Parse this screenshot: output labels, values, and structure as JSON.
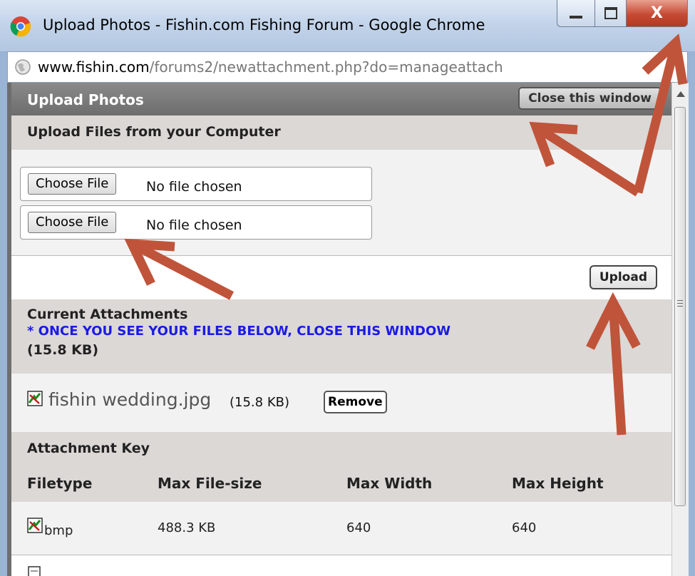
{
  "window": {
    "title": "Upload Photos - Fishin.com Fishing Forum - Google Chrome",
    "minimize_icon": "minimize-icon",
    "maximize_icon": "maximize-icon",
    "close_label": "X"
  },
  "address": {
    "host": "www.fishin.com",
    "path": "/forums2/newattachment.php?do=manageattach"
  },
  "panel": {
    "title": "Upload Photos",
    "close_window": "Close this window"
  },
  "upload": {
    "section_title": "Upload Files from your Computer",
    "choose_label": "Choose File",
    "no_file": "No file chosen",
    "upload_button": "Upload"
  },
  "attachments": {
    "section_title": "Current Attachments",
    "notice": "* ONCE YOU SEE YOUR FILES BELOW, CLOSE THIS WINDOW",
    "total": "(15.8 KB)",
    "files": [
      {
        "name": "fishin wedding.jpg",
        "size": "(15.8 KB)",
        "remove": "Remove"
      }
    ]
  },
  "key": {
    "title": "Attachment Key",
    "columns": [
      "Filetype",
      "Max File-size",
      "Max Width",
      "Max Height"
    ],
    "rows": [
      [
        "bmp",
        "488.3 KB",
        "640",
        "640"
      ]
    ]
  },
  "colors": {
    "annotation_arrow": "#c0543a",
    "notice_text": "#1a1ae6",
    "panel_header": "#7a7a7a"
  }
}
